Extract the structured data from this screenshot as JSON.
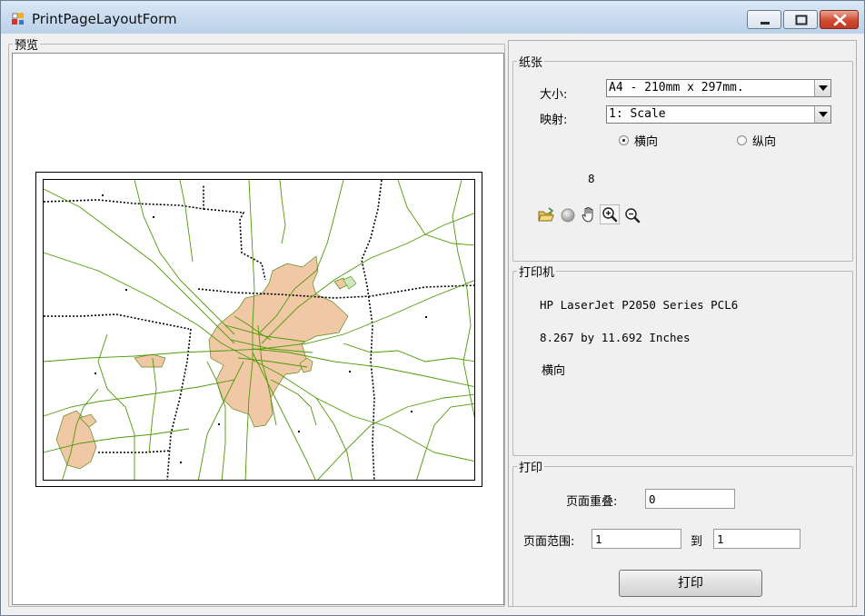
{
  "window": {
    "title": "PrintPageLayoutForm",
    "app_icon": "form-icon"
  },
  "title_controls": {
    "minimize": "minimize-icon",
    "maximize": "maximize-icon",
    "close": "close-icon"
  },
  "preview": {
    "group_label": "预览"
  },
  "paper": {
    "group_label": "纸张",
    "size_label": "大小:",
    "size_value": "A4 - 210mm x 297mm.",
    "mapping_label": "映射:",
    "mapping_value": "1: Scale",
    "orientation_landscape": "横向",
    "orientation_portrait": "纵向",
    "orientation_selected": "横向",
    "count": "8",
    "tools": [
      "open-folder-icon",
      "record-icon",
      "pan-hand-icon",
      "zoom-in-icon",
      "zoom-out-icon"
    ]
  },
  "printer": {
    "group_label": "打印机",
    "name": "HP LaserJet P2050 Series PCL6",
    "size": "8.267 by 11.692 Inches",
    "orientation": "横向"
  },
  "print": {
    "group_label": "打印",
    "overlap_label": "页面重叠:",
    "overlap_value": "0",
    "range_label": "页面范围:",
    "range_from": "1",
    "range_to_label": "到",
    "range_to": "1",
    "print_button": "打印"
  },
  "colors": {
    "map_fill": "#f1c8a6",
    "map_roads": "#4e9a06",
    "map_border": "#000000"
  }
}
